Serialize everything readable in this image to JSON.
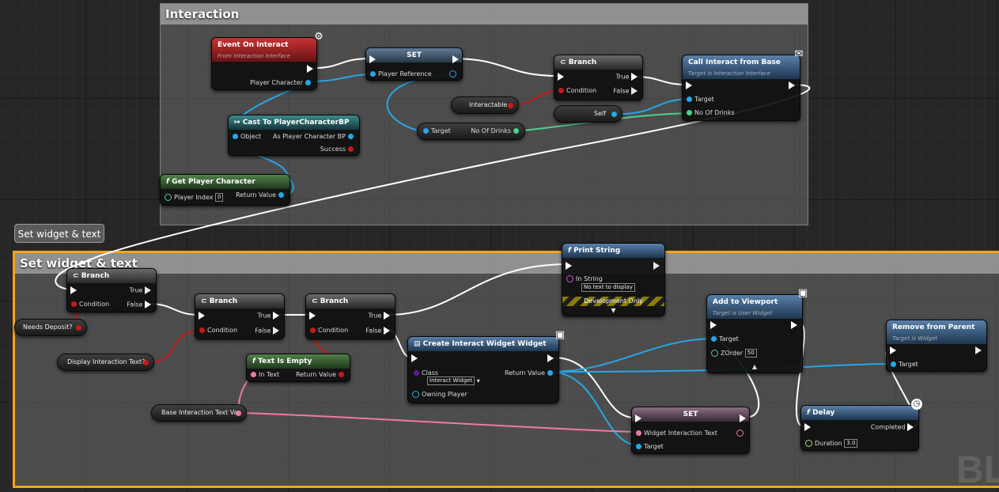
{
  "comments": {
    "interaction": "Interaction",
    "set_widget": "Set widget & text",
    "bubble": "Set widget & text"
  },
  "nodes": {
    "event_on_interact": {
      "title": "Event On Interact",
      "subtitle": "From Interaction Interface",
      "pin_player": "Player Character"
    },
    "set_player_ref": {
      "title": "SET",
      "pin_ref": "Player Reference"
    },
    "cast": {
      "title": "Cast To PlayerCharacterBP",
      "pin_object": "Object",
      "pin_as": "As Player Character BP",
      "pin_success": "Success"
    },
    "get_player_character": {
      "title": "Get Player Character",
      "pin_index": "Player Index",
      "index_value": "0",
      "pin_return": "Return Value"
    },
    "branch_top": {
      "title": "Branch",
      "pin_condition": "Condition",
      "pin_true": "True",
      "pin_false": "False"
    },
    "call_interact": {
      "title": "Call Interact from Base",
      "subtitle": "Target is Interaction Interface",
      "pin_target": "Target",
      "pin_drinks": "No Of Drinks"
    },
    "target_drinks": {
      "pin_target": "Target",
      "pin_drinks": "No Of Drinks"
    },
    "branch_a": {
      "title": "Branch",
      "pin_condition": "Condition",
      "pin_true": "True",
      "pin_false": "False"
    },
    "branch_b": {
      "title": "Branch",
      "pin_condition": "Condition",
      "pin_true": "True",
      "pin_false": "False"
    },
    "branch_c": {
      "title": "Branch",
      "pin_condition": "Condition",
      "pin_true": "True",
      "pin_false": "False"
    },
    "print_string": {
      "title": "Print String",
      "pin_in": "In String",
      "in_value": "No text to display",
      "dev": "Development Only"
    },
    "text_is_empty": {
      "title": "Text Is Empty",
      "pin_in": "In Text",
      "pin_return": "Return Value"
    },
    "create_widget": {
      "title": "Create Interact Widget Widget",
      "pin_class": "Class",
      "class_value": "Interact Widget",
      "pin_owning": "Owning Player",
      "pin_return": "Return Value"
    },
    "add_viewport": {
      "title": "Add to Viewport",
      "subtitle": "Target is User Widget",
      "pin_target": "Target",
      "pin_zorder": "ZOrder",
      "zorder_value": "50"
    },
    "set_widget_text": {
      "title": "SET",
      "pin_text": "Widget Interaction Text",
      "pin_target": "Target"
    },
    "remove_parent": {
      "title": "Remove from Parent",
      "subtitle": "Target is Widget",
      "pin_target": "Target"
    },
    "delay": {
      "title": "Delay",
      "pin_completed": "Completed",
      "pin_duration": "Duration",
      "duration_value": "3.0"
    }
  },
  "variables": {
    "interactable": "Interactable",
    "self": "Self",
    "needs_deposit": "Needs Deposit?",
    "display_text": "Display Interaction Text?",
    "base_text_var": "Base Interaction Text Var"
  },
  "watermark": "BL",
  "icons": {
    "event_badge": "interface-icon",
    "message_badge": "envelope-icon",
    "monitor_badge": "monitor-icon",
    "clock_badge": "clock-icon"
  },
  "colors": {
    "exec": "#ffffff",
    "object": "#27a7e6",
    "bool": "#c81818",
    "int": "#4fcf8f",
    "text": "#ec7aa7",
    "class": "#5b1a9c",
    "selection": "#f2a51c"
  }
}
